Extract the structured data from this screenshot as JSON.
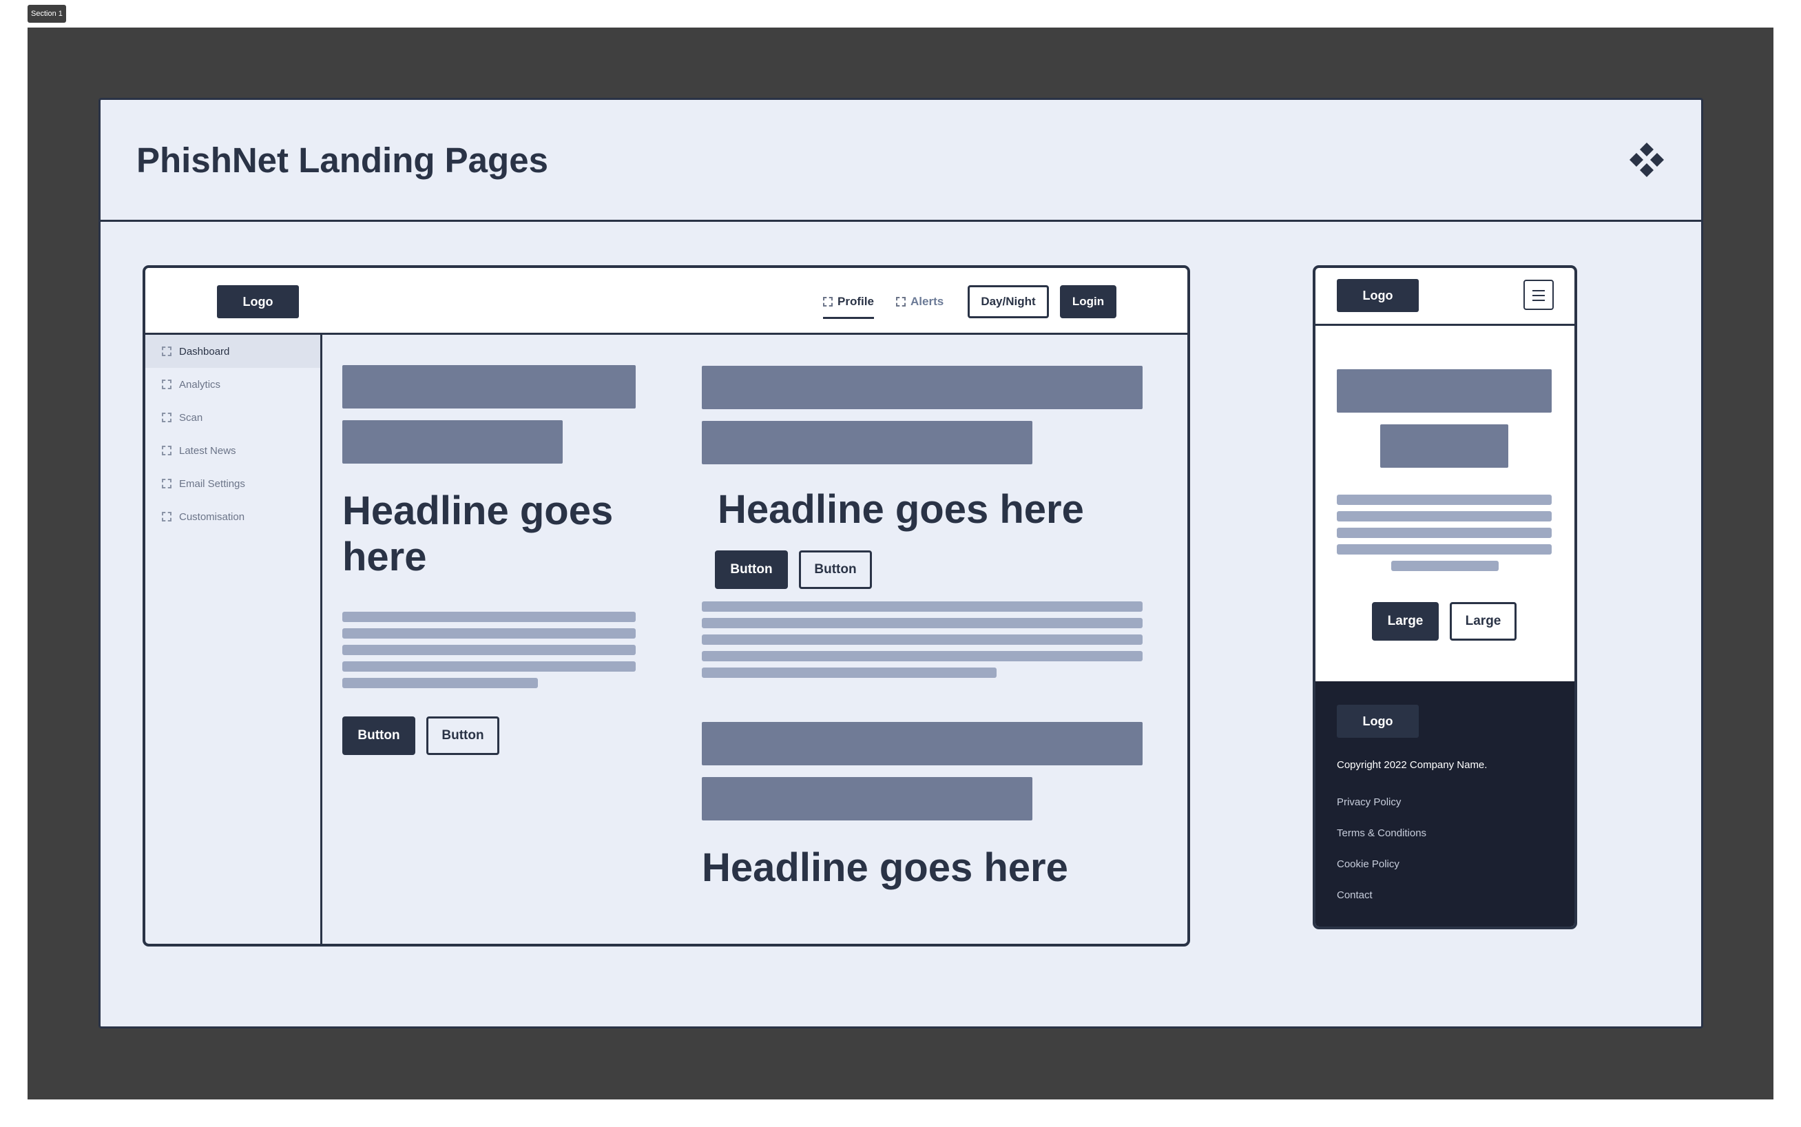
{
  "section_label": "Section 1",
  "frame": {
    "title": "PhishNet Landing Pages",
    "icon": "component-icon"
  },
  "desktop": {
    "nav": {
      "logo": "Logo",
      "links": [
        "Profile",
        "Alerts"
      ],
      "active_link": "Profile",
      "day_night": "Day/Night",
      "login": "Login"
    },
    "sidebar": {
      "items": [
        "Dashboard",
        "Analytics",
        "Scan",
        "Latest News",
        "Email Settings",
        "Customisation"
      ],
      "active": "Dashboard"
    },
    "col1": {
      "headline": "Headline goes here",
      "buttons": [
        "Button",
        "Button"
      ]
    },
    "col2": {
      "headline": "Headline goes here",
      "buttons": [
        "Button",
        "Button"
      ],
      "headline2": "Headline goes here"
    }
  },
  "mobile": {
    "nav": {
      "logo": "Logo",
      "menu_icon": "hamburger-icon"
    },
    "buttons": [
      "Large",
      "Large"
    ],
    "footer": {
      "logo": "Logo",
      "copyright": "Copyright 2022 Company Name.",
      "links": [
        "Privacy Policy",
        "Terms & Conditions",
        "Cookie Policy",
        "Contact"
      ]
    }
  },
  "colors": {
    "dark": "#2a3346",
    "frame_bg": "#eaeef7",
    "canvas_bg": "#404040",
    "placeholder_bar": "#707b96",
    "placeholder_line": "#9ea9c2",
    "footer_bg": "#1b2030"
  }
}
